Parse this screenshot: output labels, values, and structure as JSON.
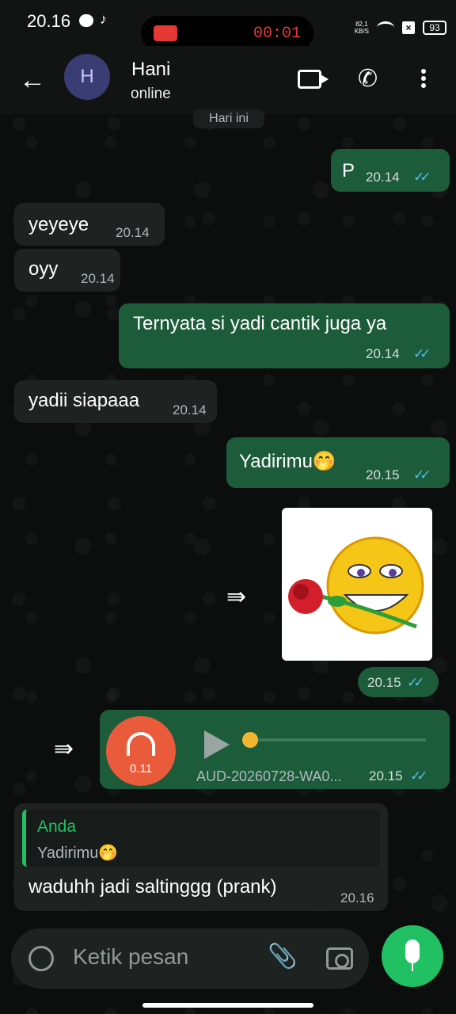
{
  "status_bar": {
    "time": "20.16",
    "recording_time": "00:01",
    "net_speed_value": "82,1",
    "net_speed_unit": "KB/S",
    "battery": "93"
  },
  "header": {
    "avatar_letter": "H",
    "contact_name": "Hani",
    "contact_status": "online"
  },
  "chat": {
    "date_chip": "Hari ini",
    "messages": [
      {
        "text": "P",
        "time": "20.14",
        "ticks": "✓✓"
      },
      {
        "text": "yeyeye",
        "time": "20.14"
      },
      {
        "text": "oyy",
        "time": "20.14"
      },
      {
        "text": "Ternyata si yadi cantik juga ya",
        "time": "20.14",
        "ticks": "✓✓"
      },
      {
        "text": "yadii siapaaa",
        "time": "20.14"
      },
      {
        "text": "Yadirimu🤭",
        "time": "20.15",
        "ticks": "✓✓"
      },
      {
        "text": "",
        "time": "20.15",
        "ticks": "✓✓"
      },
      {
        "text": "AUD-20260728-WA0...",
        "time": "20.15",
        "ticks": "✓✓",
        "duration": "0.11"
      },
      {
        "text": "waduhh jadi saltinggg (prank)",
        "time": "20.16"
      }
    ],
    "reply_quote": {
      "name": "Anda",
      "text": "Yadirimu🤭"
    }
  },
  "input_bar": {
    "placeholder": "Ketik pesan"
  },
  "colors": {
    "outgoing_bubble": "#1c5c3a",
    "incoming_bubble": "#1e2321",
    "accent_green": "#21c063",
    "read_ticks": "#53bdeb"
  }
}
